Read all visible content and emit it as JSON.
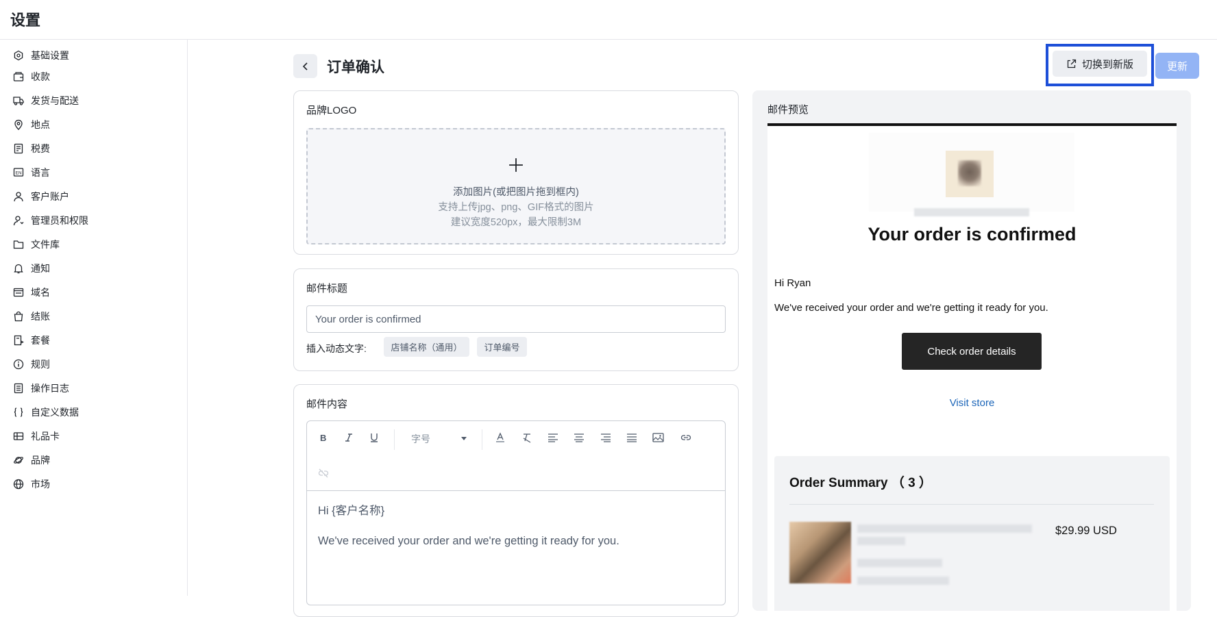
{
  "app_title": "设置",
  "sidebar": {
    "items": [
      {
        "label": "基础设置",
        "icon": "settings-icon"
      },
      {
        "label": "收款",
        "icon": "wallet-icon"
      },
      {
        "label": "发货与配送",
        "icon": "truck-icon"
      },
      {
        "label": "地点",
        "icon": "location-pin-icon"
      },
      {
        "label": "税费",
        "icon": "receipt-icon"
      },
      {
        "label": "语言",
        "icon": "language-icon"
      },
      {
        "label": "客户账户",
        "icon": "user-icon"
      },
      {
        "label": "管理员和权限",
        "icon": "user-key-icon"
      },
      {
        "label": "文件库",
        "icon": "folder-icon"
      },
      {
        "label": "通知",
        "icon": "bell-icon"
      },
      {
        "label": "域名",
        "icon": "browser-icon"
      },
      {
        "label": "结账",
        "icon": "shopping-bag-icon"
      },
      {
        "label": "套餐",
        "icon": "plan-icon"
      },
      {
        "label": "规则",
        "icon": "info-icon"
      },
      {
        "label": "操作日志",
        "icon": "log-icon"
      },
      {
        "label": "自定义数据",
        "icon": "braces-icon"
      },
      {
        "label": "礼品卡",
        "icon": "gift-card-icon"
      },
      {
        "label": "品牌",
        "icon": "planet-icon"
      },
      {
        "label": "市场",
        "icon": "globe-icon"
      }
    ]
  },
  "header": {
    "page_title": "订单确认",
    "switch_label": "切换到新版",
    "update_label": "更新"
  },
  "logo_card": {
    "title": "品牌LOGO",
    "upload_line1": "添加图片(或把图片拖到框内)",
    "upload_line2": "支持上传jpg、png、GIF格式的图片",
    "upload_line3": "建议宽度520px，最大限制3M"
  },
  "subject_card": {
    "title": "邮件标题",
    "value": "Your order is confirmed",
    "dynamic_label": "插入动态文字:",
    "chips": [
      "店铺名称（通用）",
      "订单编号"
    ]
  },
  "content_card": {
    "title": "邮件内容",
    "font_size_placeholder": "字号",
    "body_line1": "Hi {客户名称}",
    "body_line2": "We've received your order and we're getting it ready for you."
  },
  "preview": {
    "title": "邮件预览",
    "heading": "Your order is confirmed",
    "greeting": "Hi Ryan",
    "message": "We've received your order and we're getting it ready for you.",
    "button": "Check order details",
    "visit_link": "Visit store",
    "summary_title": "Order Summary （ 3 ）",
    "price": "$29.99 USD"
  },
  "colors": {
    "accent": "#1d4fd8",
    "update_button": "#93b4f5",
    "link": "#1a64b8"
  }
}
